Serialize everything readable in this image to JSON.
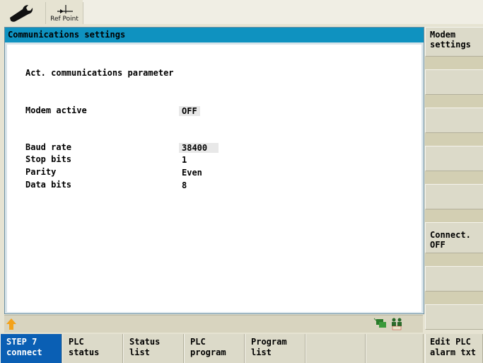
{
  "toolbar": {
    "wrench_icon": "wrench-icon",
    "refpoint_label": "Ref Point"
  },
  "panel": {
    "title": "Communications settings",
    "section_heading": "Act. communications parameter",
    "modem_active_label": "Modem active",
    "modem_active_value": "OFF",
    "baud_rate_label": "Baud rate",
    "baud_rate_value": "38400",
    "stop_bits_label": "Stop bits",
    "stop_bits_value": "1",
    "parity_label": "Parity",
    "parity_value": "Even",
    "data_bits_label": "Data bits",
    "data_bits_value": "8"
  },
  "vertical_softkeys": [
    {
      "label": "Modem\nsettings"
    },
    {
      "label": ""
    },
    {
      "label": ""
    },
    {
      "label": ""
    },
    {
      "label": ""
    },
    {
      "label": "Connect.\nOFF"
    },
    {
      "label": ""
    },
    {
      "label": ""
    }
  ],
  "horizontal_softkeys": [
    {
      "label": "STEP 7\nconnect"
    },
    {
      "label": "PLC\nstatus"
    },
    {
      "label": "Status\nlist"
    },
    {
      "label": "PLC\nprogram"
    },
    {
      "label": "Program\nlist"
    },
    {
      "label": ""
    },
    {
      "label": ""
    },
    {
      "label": "Edit PLC\nalarm txt"
    }
  ],
  "colors": {
    "title_bar": "#0f92c0",
    "active_softkey": "#0a5fb4",
    "background": "#e6e3d2"
  }
}
